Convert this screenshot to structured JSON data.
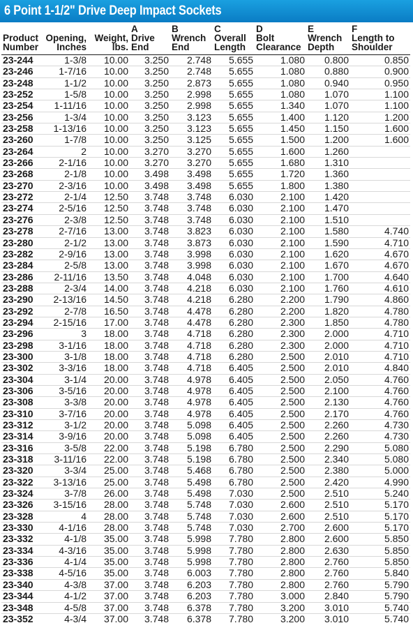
{
  "title": "6 Point 1-1/2\" Drive Deep Impact Sockets",
  "headers": [
    [
      "",
      "Product",
      "Number"
    ],
    [
      "",
      "Opening,",
      "Inches"
    ],
    [
      "",
      "Weight,",
      "lbs."
    ],
    [
      "A",
      "Drive",
      "End"
    ],
    [
      "B",
      "Wrench",
      "End"
    ],
    [
      "C",
      "Overall",
      "Length"
    ],
    [
      "D",
      "Bolt",
      "Clearance"
    ],
    [
      "E",
      "Wrench",
      "Depth"
    ],
    [
      "F",
      "Length to",
      "Shoulder"
    ]
  ],
  "rows": [
    [
      "23-244",
      "1-3/8",
      "10.00",
      "3.250",
      "2.748",
      "5.655",
      "1.080",
      "0.800",
      "0.850"
    ],
    [
      "23-246",
      "1-7/16",
      "10.00",
      "3.250",
      "2.748",
      "5.655",
      "1.080",
      "0.880",
      "0.900"
    ],
    [
      "23-248",
      "1-1/2",
      "10.00",
      "3.250",
      "2.873",
      "5.655",
      "1.080",
      "0.940",
      "0.950"
    ],
    [
      "23-252",
      "1-5/8",
      "10.00",
      "3.250",
      "2.998",
      "5.655",
      "1.080",
      "1.070",
      "1.100"
    ],
    [
      "23-254",
      "1-11/16",
      "10.00",
      "3.250",
      "2.998",
      "5.655",
      "1.340",
      "1.070",
      "1.100"
    ],
    [
      "23-256",
      "1-3/4",
      "10.00",
      "3.250",
      "3.123",
      "5.655",
      "1.400",
      "1.120",
      "1.200"
    ],
    [
      "23-258",
      "1-13/16",
      "10.00",
      "3.250",
      "3.123",
      "5.655",
      "1.450",
      "1.150",
      "1.600"
    ],
    [
      "23-260",
      "1-7/8",
      "10.00",
      "3.250",
      "3.125",
      "5.655",
      "1.500",
      "1.200",
      "1.600"
    ],
    [
      "23-264",
      "2",
      "10.00",
      "3.270",
      "3.270",
      "5.655",
      "1.600",
      "1.260",
      ""
    ],
    [
      "23-266",
      "2-1/16",
      "10.00",
      "3.270",
      "3.270",
      "5.655",
      "1.680",
      "1.310",
      ""
    ],
    [
      "23-268",
      "2-1/8",
      "10.00",
      "3.498",
      "3.498",
      "5.655",
      "1.720",
      "1.360",
      ""
    ],
    [
      "23-270",
      "2-3/16",
      "10.00",
      "3.498",
      "3.498",
      "5.655",
      "1.800",
      "1.380",
      ""
    ],
    [
      "23-272",
      "2-1/4",
      "12.50",
      "3.748",
      "3.748",
      "6.030",
      "2.100",
      "1.420",
      ""
    ],
    [
      "23-274",
      "2-5/16",
      "12.50",
      "3.748",
      "3.748",
      "6.030",
      "2.100",
      "1.470",
      ""
    ],
    [
      "23-276",
      "2-3/8",
      "12.50",
      "3.748",
      "3.748",
      "6.030",
      "2.100",
      "1.510",
      ""
    ],
    [
      "23-278",
      "2-7/16",
      "13.00",
      "3.748",
      "3.823",
      "6.030",
      "2.100",
      "1.580",
      "4.740"
    ],
    [
      "23-280",
      "2-1/2",
      "13.00",
      "3.748",
      "3.873",
      "6.030",
      "2.100",
      "1.590",
      "4.710"
    ],
    [
      "23-282",
      "2-9/16",
      "13.00",
      "3.748",
      "3.998",
      "6.030",
      "2.100",
      "1.620",
      "4.670"
    ],
    [
      "23-284",
      "2-5/8",
      "13.00",
      "3.748",
      "3.998",
      "6.030",
      "2.100",
      "1.670",
      "4.670"
    ],
    [
      "23-286",
      "2-11/16",
      "13.50",
      "3.748",
      "4.048",
      "6.030",
      "2.100",
      "1.700",
      "4.640"
    ],
    [
      "23-288",
      "2-3/4",
      "14.00",
      "3.748",
      "4.218",
      "6.030",
      "2.100",
      "1.760",
      "4.610"
    ],
    [
      "23-290",
      "2-13/16",
      "14.50",
      "3.748",
      "4.218",
      "6.280",
      "2.200",
      "1.790",
      "4.860"
    ],
    [
      "23-292",
      "2-7/8",
      "16.50",
      "3.748",
      "4.478",
      "6.280",
      "2.200",
      "1.820",
      "4.780"
    ],
    [
      "23-294",
      "2-15/16",
      "17.00",
      "3.748",
      "4.478",
      "6.280",
      "2.300",
      "1.850",
      "4.780"
    ],
    [
      "23-296",
      "3",
      "18.00",
      "3.748",
      "4.718",
      "6.280",
      "2.300",
      "2.000",
      "4.710"
    ],
    [
      "23-298",
      "3-1/16",
      "18.00",
      "3.748",
      "4.718",
      "6.280",
      "2.300",
      "2.000",
      "4.710"
    ],
    [
      "23-300",
      "3-1/8",
      "18.00",
      "3.748",
      "4.718",
      "6.280",
      "2.500",
      "2.010",
      "4.710"
    ],
    [
      "23-302",
      "3-3/16",
      "18.00",
      "3.748",
      "4.718",
      "6.405",
      "2.500",
      "2.010",
      "4.840"
    ],
    [
      "23-304",
      "3-1/4",
      "20.00",
      "3.748",
      "4.978",
      "6.405",
      "2.500",
      "2.050",
      "4.760"
    ],
    [
      "23-306",
      "3-5/16",
      "20.00",
      "3.748",
      "4.978",
      "6.405",
      "2.500",
      "2.100",
      "4.760"
    ],
    [
      "23-308",
      "3-3/8",
      "20.00",
      "3.748",
      "4.978",
      "6.405",
      "2.500",
      "2.130",
      "4.760"
    ],
    [
      "23-310",
      "3-7/16",
      "20.00",
      "3.748",
      "4.978",
      "6.405",
      "2.500",
      "2.170",
      "4.760"
    ],
    [
      "23-312",
      "3-1/2",
      "20.00",
      "3.748",
      "5.098",
      "6.405",
      "2.500",
      "2.260",
      "4.730"
    ],
    [
      "23-314",
      "3-9/16",
      "20.00",
      "3.748",
      "5.098",
      "6.405",
      "2.500",
      "2.260",
      "4.730"
    ],
    [
      "23-316",
      "3-5/8",
      "22.00",
      "3.748",
      "5.198",
      "6.780",
      "2.500",
      "2.290",
      "5.080"
    ],
    [
      "23-318",
      "3-11/16",
      "22.00",
      "3.748",
      "5.198",
      "6.780",
      "2.500",
      "2.340",
      "5.080"
    ],
    [
      "23-320",
      "3-3/4",
      "25.00",
      "3.748",
      "5.468",
      "6.780",
      "2.500",
      "2.380",
      "5.000"
    ],
    [
      "23-322",
      "3-13/16",
      "25.00",
      "3.748",
      "5.498",
      "6.780",
      "2.500",
      "2.420",
      "4.990"
    ],
    [
      "23-324",
      "3-7/8",
      "26.00",
      "3.748",
      "5.498",
      "7.030",
      "2.500",
      "2.510",
      "5.240"
    ],
    [
      "23-326",
      "3-15/16",
      "28.00",
      "3.748",
      "5.748",
      "7.030",
      "2.600",
      "2.510",
      "5.170"
    ],
    [
      "23-328",
      "4",
      "28.00",
      "3.748",
      "5.748",
      "7.030",
      "2.600",
      "2.510",
      "5.170"
    ],
    [
      "23-330",
      "4-1/16",
      "28.00",
      "3.748",
      "5.748",
      "7.030",
      "2.700",
      "2.600",
      "5.170"
    ],
    [
      "23-332",
      "4-1/8",
      "35.00",
      "3.748",
      "5.998",
      "7.780",
      "2.800",
      "2.600",
      "5.850"
    ],
    [
      "23-334",
      "4-3/16",
      "35.00",
      "3.748",
      "5.998",
      "7.780",
      "2.800",
      "2.630",
      "5.850"
    ],
    [
      "23-336",
      "4-1/4",
      "35.00",
      "3.748",
      "5.998",
      "7.780",
      "2.800",
      "2.760",
      "5.850"
    ],
    [
      "23-338",
      "4-5/16",
      "35.00",
      "3.748",
      "6.003",
      "7.780",
      "2.800",
      "2.760",
      "5.840"
    ],
    [
      "23-340",
      "4-3/8",
      "37.00",
      "3.748",
      "6.203",
      "7.780",
      "2.800",
      "2.760",
      "5.790"
    ],
    [
      "23-344",
      "4-1/2",
      "37.00",
      "3.748",
      "6.203",
      "7.780",
      "3.000",
      "2.840",
      "5.790"
    ],
    [
      "23-348",
      "4-5/8",
      "37.00",
      "3.748",
      "6.378",
      "7.780",
      "3.200",
      "3.010",
      "5.740"
    ],
    [
      "23-352",
      "4-3/4",
      "37.00",
      "3.748",
      "6.378",
      "7.780",
      "3.200",
      "3.010",
      "5.740"
    ]
  ],
  "colors": {
    "title_bar": "#0a7cc4",
    "title_text": "#ffffff"
  }
}
